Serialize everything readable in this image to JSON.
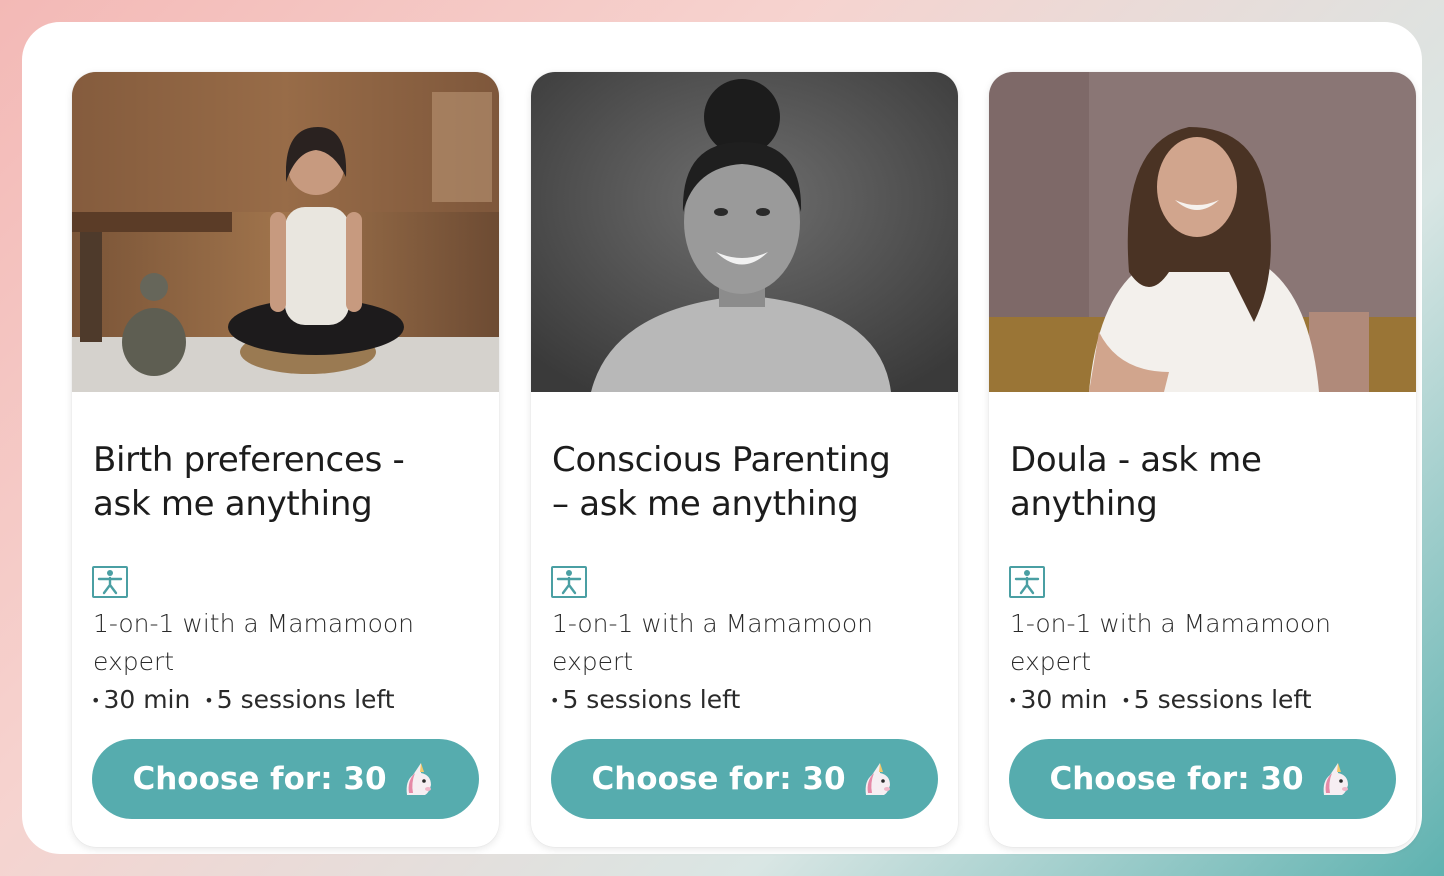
{
  "colors": {
    "accent": "#56acae",
    "icon": "#4a9fa3",
    "text": "#1c1c1c"
  },
  "cards": [
    {
      "title_line1": "Birth preferences -",
      "title_line2": "ask me anything",
      "type_icon": "yoga-person-icon",
      "desc_line1": "1-on-1 with a Mamamoon",
      "desc_line2": "expert",
      "meta": [
        "30 min",
        "5 sessions left"
      ],
      "button_label": "Choose for: 30",
      "button_icon": "unicorn-icon"
    },
    {
      "title_line1": "Conscious Parenting",
      "title_line2": "– ask me anything",
      "type_icon": "yoga-person-icon",
      "desc_line1": "1-on-1 with a Mamamoon",
      "desc_line2": "expert",
      "meta": [
        "5 sessions left"
      ],
      "button_label": "Choose for: 30",
      "button_icon": "unicorn-icon"
    },
    {
      "title_line1": "Doula - ask me",
      "title_line2": "anything",
      "type_icon": "yoga-person-icon",
      "desc_line1": "1-on-1 with a Mamamoon",
      "desc_line2": "expert",
      "meta": [
        "30 min",
        "5 sessions left"
      ],
      "button_label": "Choose for: 30",
      "button_icon": "unicorn-icon"
    }
  ]
}
